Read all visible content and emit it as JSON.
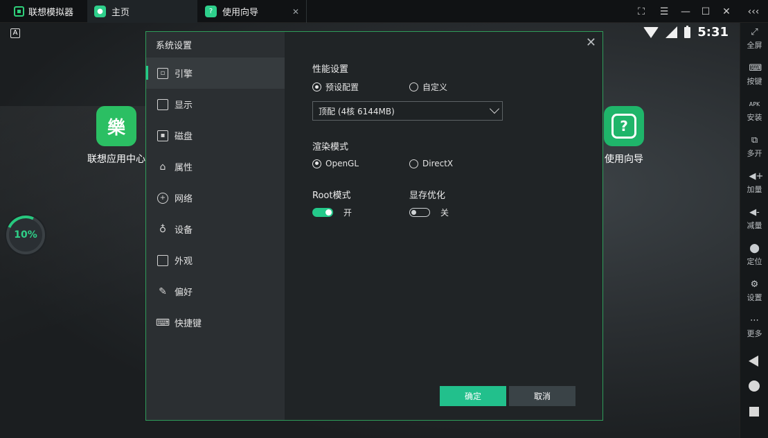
{
  "app": {
    "title": "联想模拟器"
  },
  "tabs": [
    {
      "label": "主页"
    },
    {
      "label": "使用向导"
    }
  ],
  "status_bar": {
    "time": "5:31",
    "keyboard_indicator": "A"
  },
  "desktop": {
    "apps": [
      {
        "label": "联想应用中心",
        "icon": "lenovo-app-center-icon"
      },
      {
        "label": "使用向导",
        "icon": "help-guide-icon"
      }
    ],
    "progress": {
      "value": 10,
      "text": "10%"
    }
  },
  "sidebar": {
    "items": [
      {
        "label": "全屏",
        "icon": "fullscreen-icon"
      },
      {
        "label": "按键",
        "icon": "keyboard-icon"
      },
      {
        "label": "安装",
        "icon": "apk-install-icon"
      },
      {
        "label": "多开",
        "icon": "multi-instance-icon"
      },
      {
        "label": "加量",
        "icon": "volume-up-icon"
      },
      {
        "label": "减量",
        "icon": "volume-down-icon"
      },
      {
        "label": "定位",
        "icon": "location-icon"
      },
      {
        "label": "设置",
        "icon": "settings-gear-icon"
      },
      {
        "label": "更多",
        "icon": "more-dots-icon"
      }
    ]
  },
  "dialog": {
    "title": "系统设置",
    "nav": [
      {
        "label": "引擎",
        "icon": "cpu-icon",
        "active": true
      },
      {
        "label": "显示",
        "icon": "monitor-icon"
      },
      {
        "label": "磁盘",
        "icon": "disk-icon"
      },
      {
        "label": "属性",
        "icon": "tag-icon"
      },
      {
        "label": "网络",
        "icon": "globe-icon"
      },
      {
        "label": "设备",
        "icon": "microphone-icon"
      },
      {
        "label": "外观",
        "icon": "window-icon"
      },
      {
        "label": "偏好",
        "icon": "wrench-icon"
      },
      {
        "label": "快捷键",
        "icon": "keyboard-icon"
      }
    ],
    "performance": {
      "title": "性能设置",
      "options": [
        "预设配置",
        "自定义"
      ],
      "selected": "预设配置",
      "preset_value": "顶配 (4核 6144MB)"
    },
    "render": {
      "title": "渲染模式",
      "options": [
        "OpenGL",
        "DirectX"
      ],
      "selected": "OpenGL"
    },
    "root": {
      "title": "Root模式",
      "state_label": "开",
      "on": true
    },
    "vram": {
      "title": "显存优化",
      "state_label": "关",
      "on": false
    },
    "buttons": {
      "ok": "确定",
      "cancel": "取消"
    }
  },
  "colors": {
    "accent": "#24c98a",
    "border": "#2f9d5a"
  }
}
